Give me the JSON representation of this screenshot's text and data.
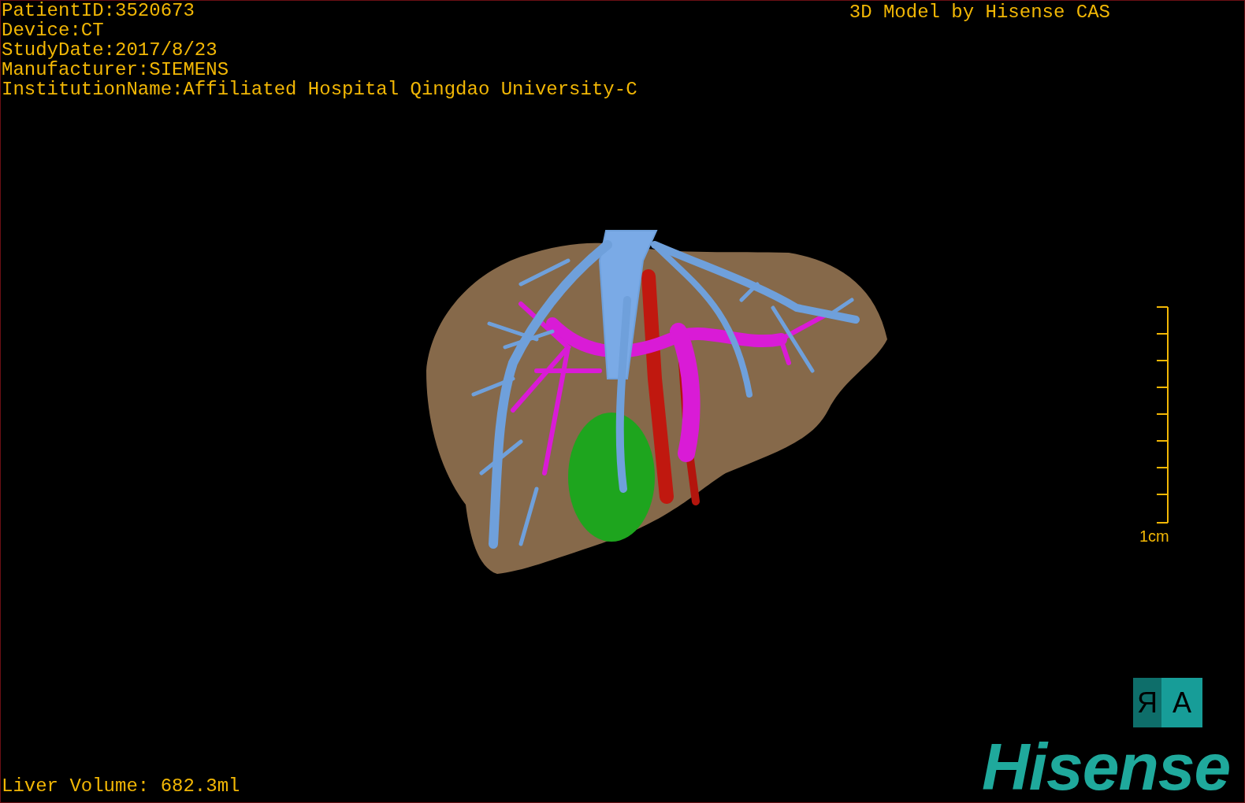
{
  "info_lines": [
    "PatientID:3520673",
    "Device:CT",
    "StudyDate:2017/8/23",
    "Manufacturer:SIEMENS",
    "InstitutionName:Affiliated Hospital Qingdao University-C"
  ],
  "title": "3D Model by Hisense CAS",
  "scale_bar": {
    "label": "1cm"
  },
  "orientation_cube": {
    "faces": [
      {
        "label": "R",
        "mirrored": true
      },
      {
        "label": "A",
        "mirrored": false
      }
    ]
  },
  "logo": "Hisense",
  "liver_volume": "Liver Volume: 682.3ml"
}
